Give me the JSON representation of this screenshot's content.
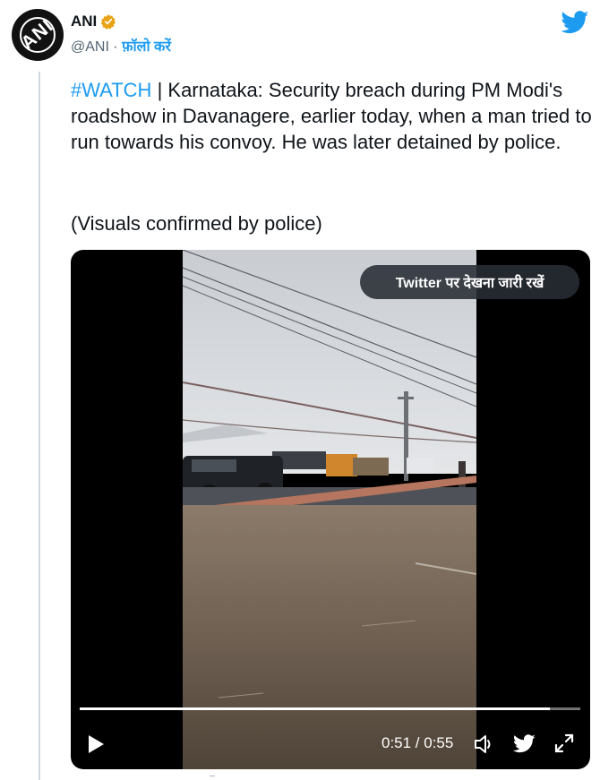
{
  "account": {
    "name": "ANI",
    "handle": "@ANI",
    "separator": " · ",
    "follow_label": "फ़ॉलो करें",
    "avatar_text": "ANI"
  },
  "tweet": {
    "hashtag": "#WATCH",
    "body": " | Karnataka: Security breach during PM Modi's roadshow in Davanagere, earlier today, when a man tried to run towards his convoy. He was later detained by police.",
    "note": "(Visuals confirmed by police)"
  },
  "video": {
    "watch_on_twitter": "Twitter पर देखना जारी रखें",
    "time": "0:51 / 0:55",
    "progress": 0.94
  },
  "colors": {
    "accent": "#1d9bf0",
    "verified": "#e8a317",
    "text": "#0f1419",
    "muted": "#536471"
  },
  "icons": [
    "verified-badge-icon",
    "twitter-bird-icon",
    "play-icon",
    "volume-icon",
    "twitter-icon",
    "expand-icon"
  ]
}
